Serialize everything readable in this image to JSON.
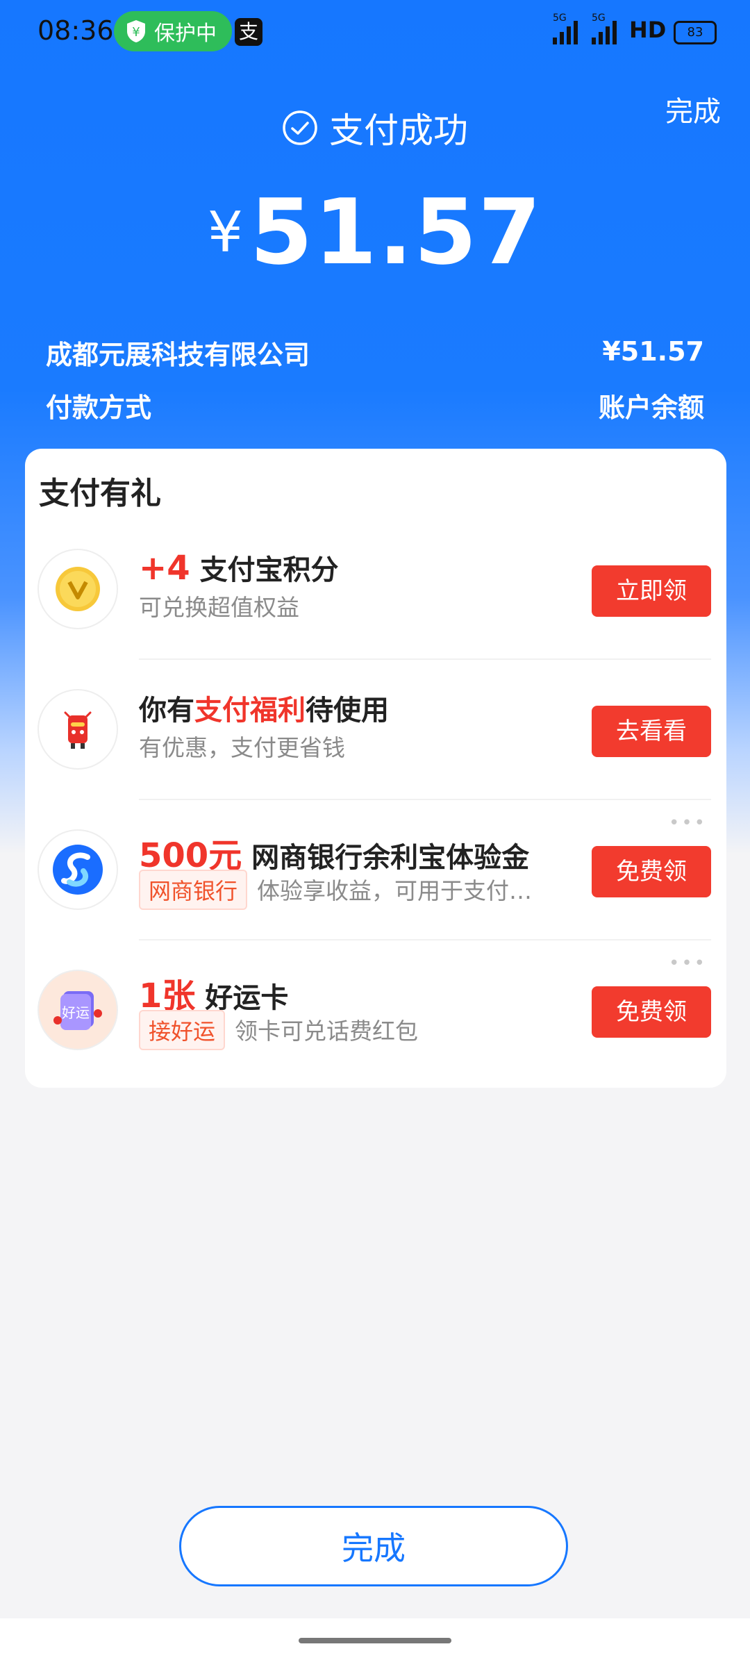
{
  "status_bar": {
    "time": "08:36",
    "protection": "保护中",
    "network_1": "5G",
    "network_2": "5G",
    "hd": "HD",
    "battery": "83"
  },
  "header": {
    "done_top": "完成",
    "status_text": "支付成功",
    "currency": "¥",
    "amount": "51.57"
  },
  "summary": {
    "merchant": "成都元展科技有限公司",
    "merchant_amount": "¥51.57",
    "pay_method_label": "付款方式",
    "pay_method_value": "账户余额"
  },
  "rewards": {
    "title": "支付有礼",
    "items": [
      {
        "highlight": "+4",
        "title": "支付宝积分",
        "subtitle": "可兑换超值权益",
        "button": "立即领",
        "icon": "coin-v-icon"
      },
      {
        "prefix": "你有",
        "highlight": "支付福利",
        "suffix": "待使用",
        "subtitle": "有优惠，支付更省钱",
        "button": "去看看",
        "icon": "red-envelope-mascot-icon"
      },
      {
        "highlight": "500元",
        "title": "网商银行余利宝体验金",
        "tag": "网商银行",
        "subtitle": "体验享收益，可用于支付…",
        "button": "免费领",
        "icon": "mybank-logo-icon"
      },
      {
        "highlight": "1张",
        "title": "好运卡",
        "tag": "接好运",
        "subtitle": "领卡可兑话费红包",
        "button": "免费领",
        "icon": "lucky-card-icon",
        "icon_text": "好运"
      }
    ]
  },
  "footer": {
    "done_button": "完成"
  },
  "colors": {
    "brand_blue": "#1677ff",
    "accent_red": "#f23b2e",
    "success_green": "#2ebd5a"
  }
}
